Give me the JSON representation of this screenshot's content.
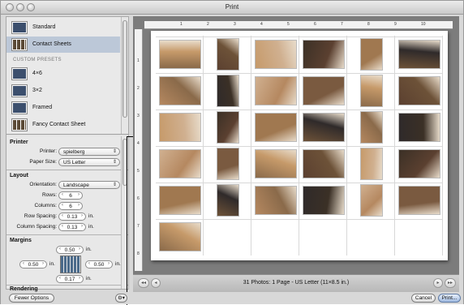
{
  "window": {
    "title": "Print"
  },
  "presets": {
    "items": [
      {
        "label": "Standard"
      },
      {
        "label": "Contact Sheets",
        "selected": true
      },
      {
        "label": "4×6"
      },
      {
        "label": "3×2"
      },
      {
        "label": "Framed"
      },
      {
        "label": "Fancy Contact Sheet"
      }
    ],
    "custom_header": "CUSTOM PRESETS"
  },
  "printer_section": {
    "header": "Printer",
    "printer_label": "Printer:",
    "printer_value": "spielberg",
    "paper_label": "Paper Size:",
    "paper_value": "US Letter"
  },
  "layout_section": {
    "header": "Layout",
    "orientation_label": "Orientation:",
    "orientation_value": "Landscape",
    "rows_label": "Rows:",
    "rows_value": "6",
    "columns_label": "Columns:",
    "columns_value": "6",
    "row_spacing_label": "Row Spacing:",
    "row_spacing_value": "0.13",
    "column_spacing_label": "Column Spacing:",
    "column_spacing_value": "0.13",
    "unit": "in."
  },
  "margins_section": {
    "header": "Margins",
    "top": "0.50",
    "left": "0.50",
    "right": "0.50",
    "bottom": "0.17",
    "unit": "in."
  },
  "rendering_header": "Rendering",
  "ruler": {
    "h_ticks": [
      "1",
      "2",
      "3",
      "4",
      "5",
      "6",
      "7",
      "8",
      "9",
      "10"
    ],
    "v_ticks": [
      "1",
      "2",
      "3",
      "4",
      "5",
      "6",
      "7",
      "8"
    ]
  },
  "status": "31 Photos: 1 Page - US Letter (11×8.5 in.)",
  "nav": {
    "first": "◂◂",
    "prev": "◂",
    "next": "▸",
    "last": "▸▸"
  },
  "footer": {
    "fewer_options": "Fewer Options",
    "gear": "⚙▾",
    "cancel": "Cancel",
    "print": "Print..."
  },
  "photo_count": 31,
  "colors": {
    "selected_row": "#bcc8d8",
    "default_button": "#9fb9df"
  }
}
